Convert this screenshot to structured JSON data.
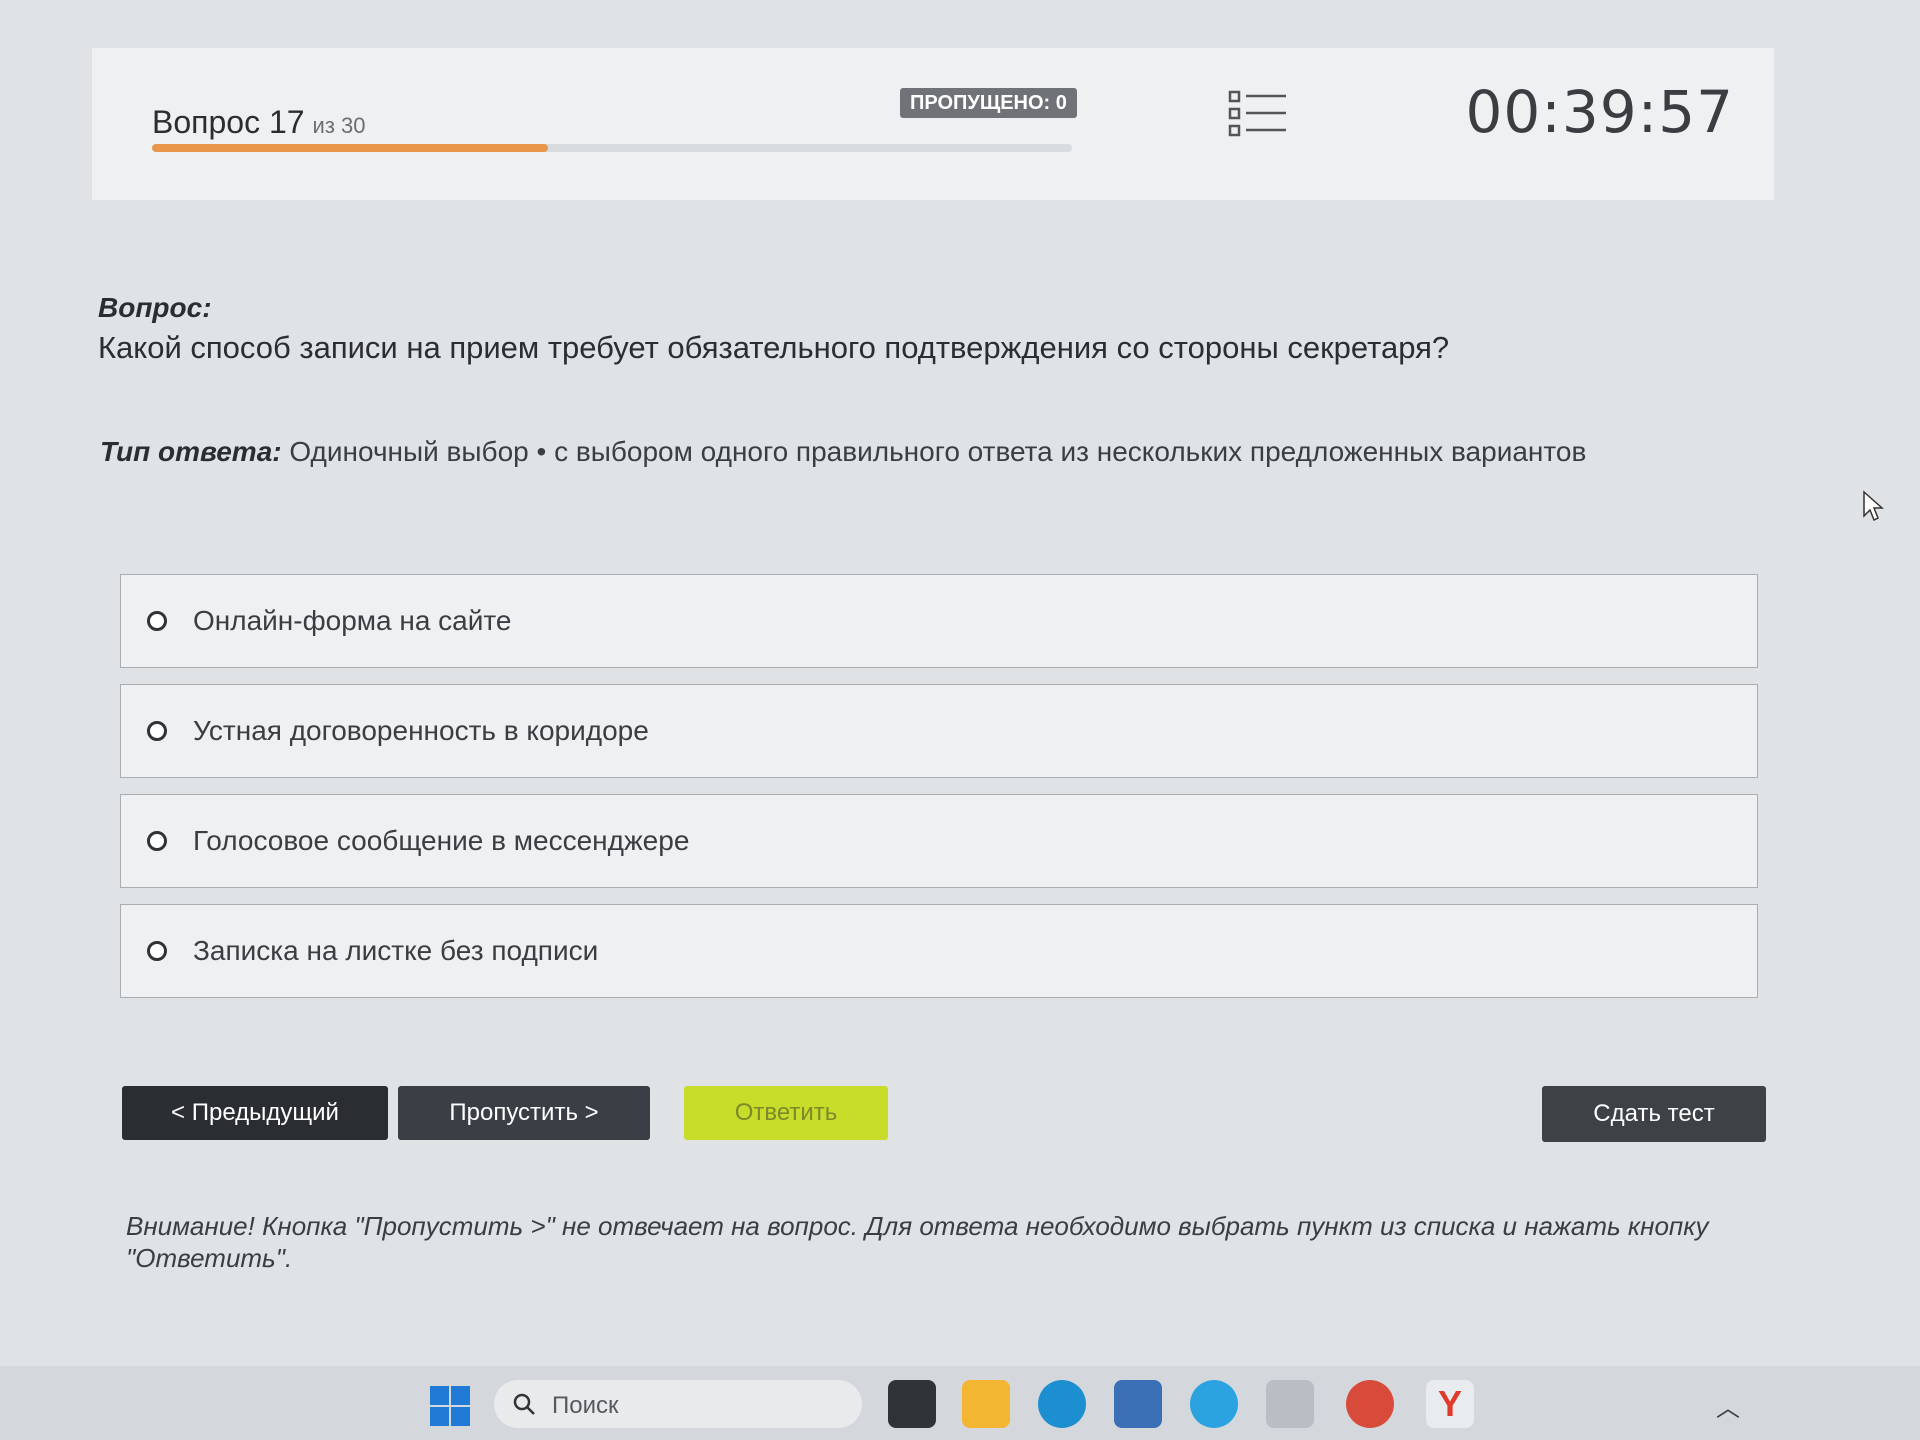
{
  "header": {
    "question_label": "Вопрос 17",
    "question_of": "из 30",
    "progress_fraction": 0.43,
    "skipped_badge": "ПРОПУЩЕНО: 0",
    "timer": "00:39:57"
  },
  "question": {
    "label": "Вопрос:",
    "text": "Какой способ записи на прием требует обязательного подтверждения со стороны секретаря?",
    "answer_type_label": "Тип ответа:",
    "answer_type_value": "Одиночный выбор • с выбором одного правильного ответа из нескольких предложенных вариантов"
  },
  "options": [
    {
      "label": "Онлайн-форма на сайте"
    },
    {
      "label": "Устная договоренность в коридоре"
    },
    {
      "label": "Голосовое сообщение в мессенджере"
    },
    {
      "label": "Записка на листке без подписи"
    }
  ],
  "buttons": {
    "prev": "< Предыдущий",
    "skip": "Пропустить >",
    "answer": "Ответить",
    "submit": "Сдать тест"
  },
  "warning": "Внимание! Кнопка \"Пропустить >\" не отвечает на вопрос. Для ответа необходимо выбрать пункт из списка и нажать кнопку \"Ответить\".",
  "taskbar": {
    "search_placeholder": "Поиск",
    "apps": [
      "task-view-icon",
      "file-explorer-icon",
      "edge-icon",
      "store-icon",
      "telegram-icon",
      "photos-icon",
      "chrome-icon",
      "yandex-browser-icon"
    ]
  },
  "colors": {
    "progress": "#e8964a",
    "answer_button": "#c8dc2a",
    "dark_button": "#2a2e33"
  }
}
